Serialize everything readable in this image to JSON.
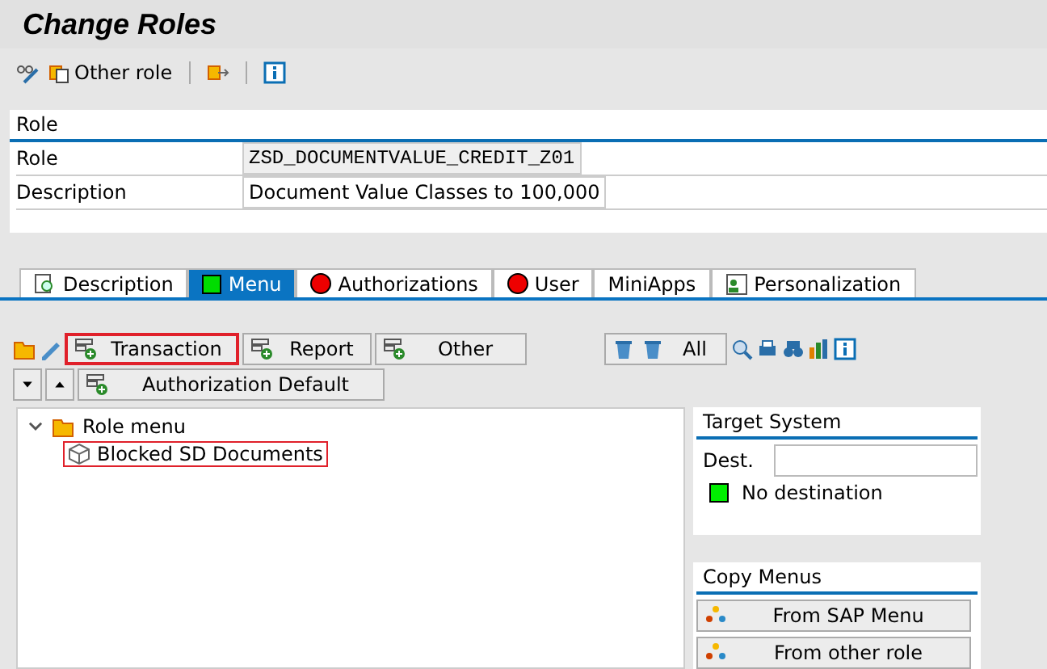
{
  "title": "Change Roles",
  "toolbar": [
    {
      "kind": "glasses"
    },
    {
      "kind": "other-role",
      "label": "Other role"
    },
    {
      "kind": "sep"
    },
    {
      "kind": "transport"
    },
    {
      "kind": "sep"
    },
    {
      "kind": "info"
    }
  ],
  "role_panel": {
    "heading": "Role",
    "fields": [
      {
        "label": "Role",
        "value": "ZSD_DOCUMENTVALUE_CREDIT_Z01",
        "disabled": true
      },
      {
        "label": "Description",
        "value": "Document Value Classes to 100,000",
        "disabled": false
      }
    ]
  },
  "tabs": [
    {
      "label": "Description",
      "kind": "icon",
      "selected": false
    },
    {
      "label": "Menu",
      "kind": "status",
      "color": "#00dd00",
      "selected": true
    },
    {
      "label": "Authorizations",
      "kind": "status",
      "color": "#ee0000",
      "selected": false
    },
    {
      "label": "User",
      "kind": "status",
      "color": "#ee0000",
      "selected": false
    },
    {
      "label": "MiniApps",
      "kind": "plain",
      "selected": false
    },
    {
      "label": "Personalization",
      "kind": "person",
      "selected": false
    }
  ],
  "menu_buttons": [
    {
      "label": "Transaction",
      "highlighted": true
    },
    {
      "label": "Report",
      "highlighted": false
    },
    {
      "label": "Other",
      "highlighted": false
    }
  ],
  "auth_default": {
    "label": "Authorization Default"
  },
  "delete_all": {
    "label": "All"
  },
  "tree": {
    "label": "Role menu",
    "expanded": true,
    "children": [
      {
        "label": "Blocked SD Documents",
        "highlighted": true
      }
    ]
  },
  "target_system": {
    "heading": "Target System",
    "dest_label": "Dest.",
    "color": "#00ee00",
    "status_text": "No destination"
  },
  "copy_menus": {
    "heading": "Copy Menus",
    "buttons": [
      "From SAP Menu",
      "From other role"
    ]
  }
}
